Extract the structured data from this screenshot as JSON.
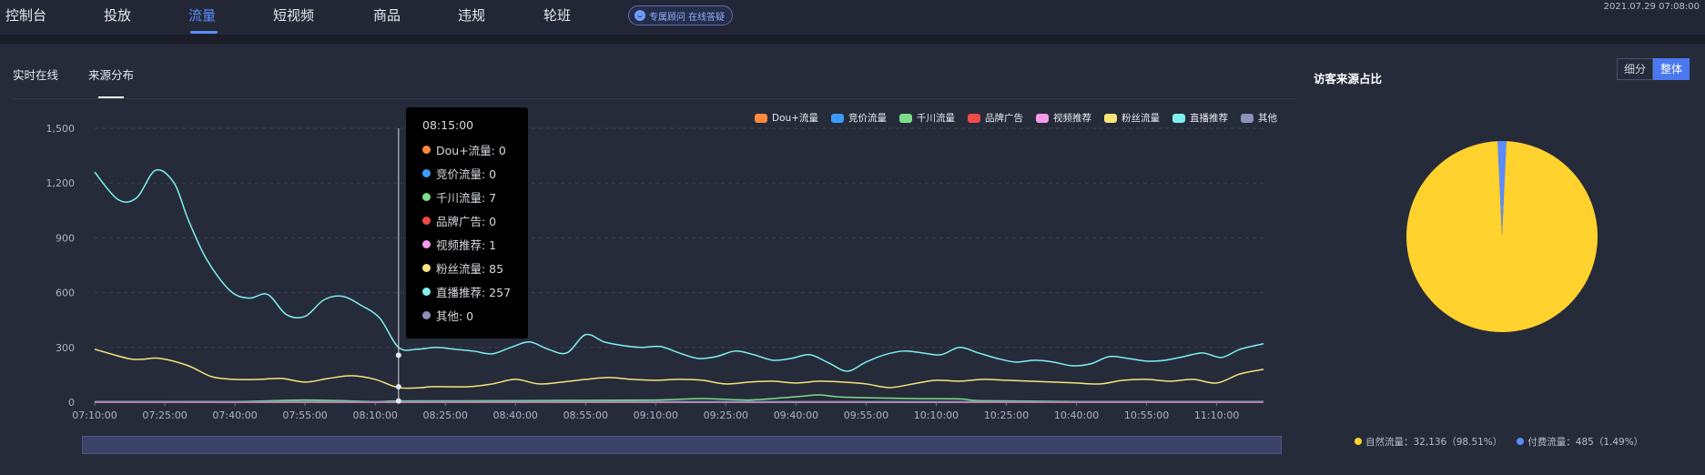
{
  "nav": {
    "items": [
      {
        "label": "控制台",
        "active": false
      },
      {
        "label": "投放",
        "active": false
      },
      {
        "label": "流量",
        "active": true
      },
      {
        "label": "短视频",
        "active": false
      },
      {
        "label": "商品",
        "active": false
      },
      {
        "label": "违规",
        "active": false
      },
      {
        "label": "轮班",
        "active": false
      }
    ],
    "consult_label": "专属顾问 在线答疑",
    "datetime": "2021.07.29 07:08:00"
  },
  "tabs": {
    "realtime": "实时在线",
    "source": "来源分布"
  },
  "side": {
    "title": "访客来源占比",
    "toggle_detail": "细分",
    "toggle_total": "整体",
    "legend": [
      {
        "label": "自然流量：32,136（98.51%）",
        "color": "#ffd22e"
      },
      {
        "label": "付费流量：485（1.49%）",
        "color": "#5b8cff"
      }
    ]
  },
  "tooltip": {
    "time": "08:15:00",
    "rows": [
      {
        "label": "Dou+流量: 0",
        "color": "#ff8a3d"
      },
      {
        "label": "竞价流量: 0",
        "color": "#3d9bff"
      },
      {
        "label": "千川流量: 7",
        "color": "#7ddc8a"
      },
      {
        "label": "品牌广告: 0",
        "color": "#f04b4b"
      },
      {
        "label": "视频推荐: 1",
        "color": "#f59ae8"
      },
      {
        "label": "粉丝流量: 85",
        "color": "#f7e57a"
      },
      {
        "label": "直播推荐: 257",
        "color": "#7ff0ee"
      },
      {
        "label": "其他: 0",
        "color": "#8c92b8"
      }
    ]
  },
  "chart_data": [
    {
      "type": "line",
      "x_ticks": [
        "07:10:00",
        "07:25:00",
        "07:40:00",
        "07:55:00",
        "08:10:00",
        "08:25:00",
        "08:40:00",
        "08:55:00",
        "09:10:00",
        "09:25:00",
        "09:40:00",
        "09:55:00",
        "10:10:00",
        "10:25:00",
        "10:40:00",
        "10:55:00",
        "11:10:00"
      ],
      "y_ticks": [
        "0",
        "300",
        "600",
        "900",
        "1,200",
        "1,500"
      ],
      "ylim": [
        0,
        1500
      ],
      "x_range_minutes": [
        0,
        250
      ],
      "grid": true,
      "legend_position": "top-right",
      "series": [
        {
          "name": "Dou+流量",
          "color": "#ff8a3d",
          "points": [
            [
              0,
              0
            ],
            [
              250,
              0
            ]
          ]
        },
        {
          "name": "竞价流量",
          "color": "#3d9bff",
          "points": [
            [
              0,
              0
            ],
            [
              250,
              0
            ]
          ]
        },
        {
          "name": "千川流量",
          "color": "#7ddc8a",
          "points": [
            [
              0,
              4
            ],
            [
              30,
              4
            ],
            [
              45,
              12
            ],
            [
              60,
              4
            ],
            [
              65,
              7
            ],
            [
              85,
              8
            ],
            [
              100,
              10
            ],
            [
              120,
              12
            ],
            [
              130,
              20
            ],
            [
              140,
              12
            ],
            [
              150,
              30
            ],
            [
              155,
              40
            ],
            [
              160,
              28
            ],
            [
              175,
              20
            ],
            [
              185,
              18
            ],
            [
              190,
              8
            ],
            [
              210,
              4
            ],
            [
              250,
              4
            ]
          ]
        },
        {
          "name": "品牌广告",
          "color": "#f04b4b",
          "points": [
            [
              0,
              0
            ],
            [
              250,
              0
            ]
          ]
        },
        {
          "name": "视频推荐",
          "color": "#f59ae8",
          "points": [
            [
              0,
              2
            ],
            [
              65,
              1
            ],
            [
              250,
              2
            ]
          ]
        },
        {
          "name": "粉丝流量",
          "color": "#f7e57a",
          "points": [
            [
              0,
              290
            ],
            [
              7,
              240
            ],
            [
              10,
              235
            ],
            [
              14,
              240
            ],
            [
              20,
              200
            ],
            [
              25,
              140
            ],
            [
              30,
              125
            ],
            [
              35,
              125
            ],
            [
              40,
              130
            ],
            [
              45,
              110
            ],
            [
              50,
              130
            ],
            [
              55,
              145
            ],
            [
              60,
              125
            ],
            [
              65,
              80
            ],
            [
              70,
              80
            ],
            [
              72,
              85
            ],
            [
              80,
              85
            ],
            [
              85,
              100
            ],
            [
              90,
              125
            ],
            [
              95,
              100
            ],
            [
              100,
              110
            ],
            [
              105,
              125
            ],
            [
              110,
              135
            ],
            [
              115,
              125
            ],
            [
              120,
              120
            ],
            [
              125,
              125
            ],
            [
              130,
              120
            ],
            [
              135,
              100
            ],
            [
              140,
              110
            ],
            [
              145,
              115
            ],
            [
              150,
              105
            ],
            [
              155,
              115
            ],
            [
              160,
              110
            ],
            [
              165,
              100
            ],
            [
              170,
              80
            ],
            [
              175,
              100
            ],
            [
              180,
              120
            ],
            [
              185,
              115
            ],
            [
              190,
              125
            ],
            [
              195,
              120
            ],
            [
              200,
              115
            ],
            [
              205,
              110
            ],
            [
              210,
              105
            ],
            [
              215,
              100
            ],
            [
              220,
              120
            ],
            [
              225,
              125
            ],
            [
              230,
              115
            ],
            [
              235,
              125
            ],
            [
              240,
              105
            ],
            [
              245,
              155
            ],
            [
              250,
              180
            ]
          ]
        },
        {
          "name": "直播推荐",
          "color": "#7ff0ee",
          "points": [
            [
              0,
              1260
            ],
            [
              5,
              1110
            ],
            [
              9,
              1120
            ],
            [
              13,
              1270
            ],
            [
              17,
              1200
            ],
            [
              20,
              1000
            ],
            [
              24,
              780
            ],
            [
              29,
              610
            ],
            [
              33,
              570
            ],
            [
              37,
              590
            ],
            [
              41,
              480
            ],
            [
              45,
              470
            ],
            [
              49,
              560
            ],
            [
              53,
              580
            ],
            [
              57,
              530
            ],
            [
              61,
              460
            ],
            [
              65,
              300
            ],
            [
              69,
              290
            ],
            [
              73,
              300
            ],
            [
              77,
              290
            ],
            [
              81,
              280
            ],
            [
              85,
              265
            ],
            [
              89,
              300
            ],
            [
              93,
              330
            ],
            [
              97,
              290
            ],
            [
              101,
              270
            ],
            [
              105,
              370
            ],
            [
              109,
              330
            ],
            [
              113,
              310
            ],
            [
              117,
              300
            ],
            [
              121,
              305
            ],
            [
              125,
              270
            ],
            [
              129,
              240
            ],
            [
              133,
              250
            ],
            [
              137,
              280
            ],
            [
              141,
              260
            ],
            [
              145,
              230
            ],
            [
              149,
              240
            ],
            [
              153,
              260
            ],
            [
              157,
              215
            ],
            [
              161,
              170
            ],
            [
              165,
              220
            ],
            [
              169,
              260
            ],
            [
              173,
              280
            ],
            [
              177,
              270
            ],
            [
              181,
              260
            ],
            [
              185,
              300
            ],
            [
              189,
              270
            ],
            [
              193,
              240
            ],
            [
              197,
              220
            ],
            [
              201,
              230
            ],
            [
              205,
              220
            ],
            [
              209,
              200
            ],
            [
              213,
              210
            ],
            [
              217,
              250
            ],
            [
              221,
              240
            ],
            [
              225,
              225
            ],
            [
              229,
              230
            ],
            [
              233,
              250
            ],
            [
              237,
              270
            ],
            [
              241,
              245
            ],
            [
              245,
              290
            ],
            [
              250,
              320
            ]
          ]
        },
        {
          "name": "其他",
          "color": "#8c92b8",
          "points": [
            [
              0,
              3
            ],
            [
              250,
              3
            ]
          ]
        }
      ]
    },
    {
      "type": "pie",
      "slices": [
        {
          "name": "自然流量",
          "value": 32136,
          "percent": 98.51,
          "color": "#ffd22e"
        },
        {
          "name": "付费流量",
          "value": 485,
          "percent": 1.49,
          "color": "#5b8cff"
        }
      ]
    }
  ]
}
